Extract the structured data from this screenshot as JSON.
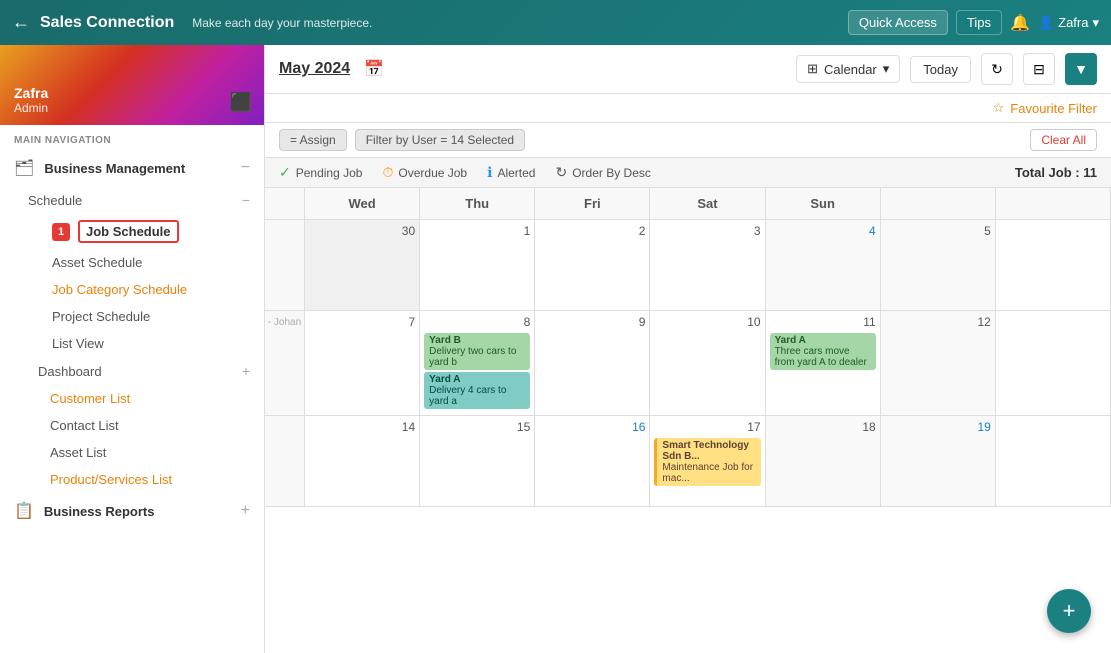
{
  "header": {
    "back_label": "←",
    "logo": "Sales Connection",
    "tagline": "Make each day your masterpiece.",
    "quick_access": "Quick Access",
    "tips": "Tips",
    "user": "Zafra",
    "user_chevron": "▾"
  },
  "sidebar": {
    "user_name": "Zafra",
    "user_role": "Admin",
    "nav_section_label": "MAIN NAVIGATION",
    "groups": [
      {
        "icon": "🗂",
        "label": "Business Management",
        "toggle": "−",
        "expanded": true,
        "sub_groups": [
          {
            "label": "Schedule",
            "toggle": "−",
            "expanded": true,
            "items": [
              {
                "label": "Job Schedule",
                "active": true,
                "badge": "1"
              },
              {
                "label": "Asset Schedule",
                "active": false
              },
              {
                "label": "Job Category Schedule",
                "active": false,
                "colored": true
              },
              {
                "label": "Project Schedule",
                "active": false
              },
              {
                "label": "List View",
                "active": false
              }
            ]
          },
          {
            "label": "Dashboard",
            "toggle": "+",
            "expanded": false,
            "items": []
          }
        ],
        "direct_items": [
          {
            "label": "Customer List",
            "colored": true
          },
          {
            "label": "Contact List"
          },
          {
            "label": "Asset List"
          },
          {
            "label": "Product/Services List",
            "colored": true
          }
        ]
      },
      {
        "icon": "📊",
        "label": "Business Reports",
        "toggle": "+"
      }
    ]
  },
  "calendar": {
    "title": "May 2024",
    "view_label": "Calendar",
    "today_label": "Today",
    "fav_filter_label": "Favourite Filter",
    "filters": [
      "= Assign",
      "Filter by User = 14 Selected"
    ],
    "clear_all": "Clear All",
    "status_items": [
      {
        "icon": "✓",
        "label": "Pending Job",
        "color": "green"
      },
      {
        "icon": "⏱",
        "label": "Overdue Job",
        "color": "orange"
      },
      {
        "icon": "ℹ",
        "label": "Alerted",
        "color": "blue"
      },
      {
        "icon": "↻",
        "label": "Order By Desc",
        "color": "default"
      }
    ],
    "total_label": "Total Job :",
    "total_count": "11",
    "headers": [
      "Wed",
      "Thu",
      "Fri",
      "Sat",
      "Sun"
    ],
    "rows": [
      {
        "week": "",
        "cells": [
          {
            "date": "30",
            "other": true
          },
          {
            "date": "1",
            "blue": false
          },
          {
            "date": "2",
            "blue": false
          },
          {
            "date": "3",
            "blue": false
          },
          {
            "date": "4",
            "blue": true,
            "weekend": true
          },
          {
            "date": "5",
            "blue": false,
            "weekend": true
          },
          {
            "date": "",
            "hidden": true
          }
        ]
      },
      {
        "week": "",
        "cells": [
          {
            "date": "7"
          },
          {
            "date": "8",
            "events": [
              {
                "type": "green",
                "title": "Yard B",
                "desc": "Delivery two cars to yard b"
              },
              {
                "type": "teal",
                "title": "Yard A",
                "desc": "Delivery 4 cars to yard a"
              }
            ]
          },
          {
            "date": "9"
          },
          {
            "date": "10"
          },
          {
            "date": "11",
            "events": [
              {
                "type": "green",
                "title": "Yard A",
                "desc": "Three cars move from yard A to dealer"
              }
            ]
          },
          {
            "date": "12",
            "weekend": true
          },
          {
            "date": "",
            "hidden": true
          }
        ]
      },
      {
        "week": "",
        "cells": [
          {
            "date": "14"
          },
          {
            "date": "15"
          },
          {
            "date": "16",
            "blue": true
          },
          {
            "date": "17",
            "events": [
              {
                "type": "amber",
                "title": "Smart Technology Sdn B...",
                "desc": "Maintenance Job for mac..."
              }
            ]
          },
          {
            "date": "18",
            "weekend": true
          },
          {
            "date": "19",
            "weekend": true
          },
          {
            "date": "",
            "hidden": true
          }
        ]
      }
    ],
    "fab_label": "+"
  }
}
